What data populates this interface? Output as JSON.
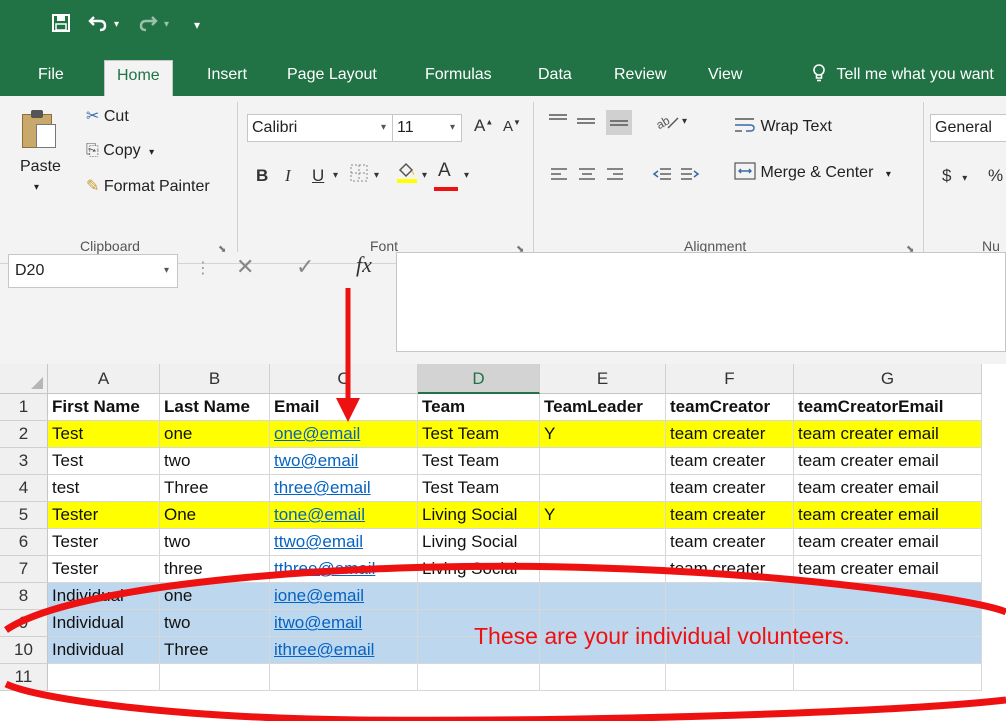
{
  "quick_access": {
    "save_icon": "save-icon",
    "undo_icon": "undo-icon",
    "redo_icon": "redo-icon",
    "customize_icon": "customize-icon"
  },
  "tabs": [
    {
      "label": "File"
    },
    {
      "label": "Home"
    },
    {
      "label": "Insert"
    },
    {
      "label": "Page Layout"
    },
    {
      "label": "Formulas"
    },
    {
      "label": "Data"
    },
    {
      "label": "Review"
    },
    {
      "label": "View"
    }
  ],
  "tell_me": "Tell me what you want",
  "ribbon": {
    "clipboard": {
      "paste": "Paste",
      "cut": "Cut",
      "copy": "Copy",
      "format_painter": "Format Painter",
      "label": "Clipboard"
    },
    "font": {
      "name": "Calibri",
      "size": "11",
      "bold": "B",
      "italic": "I",
      "underline": "U",
      "label": "Font"
    },
    "alignment": {
      "wrap_text": "Wrap Text",
      "merge_center": "Merge & Center",
      "label": "Alignment"
    },
    "number": {
      "format": "General",
      "currency": "$",
      "percent": "%",
      "label": "Nu"
    }
  },
  "formula_bar": {
    "name_box": "D20",
    "fx": "fx",
    "value": ""
  },
  "columns": [
    "A",
    "B",
    "C",
    "D",
    "E",
    "F",
    "G"
  ],
  "rows": [
    {
      "num": "1",
      "style": "header",
      "cells": [
        "First Name",
        "Last Name",
        "Email",
        "Team",
        "TeamLeader",
        "teamCreator",
        "teamCreatorEmail"
      ]
    },
    {
      "num": "2",
      "style": "yellow",
      "cells": [
        "Test",
        "one",
        "one@email",
        "Test Team",
        "Y",
        "team creater",
        "team creater email"
      ]
    },
    {
      "num": "3",
      "style": "plain",
      "cells": [
        "Test",
        "two",
        "two@email",
        "Test Team",
        "",
        "team creater",
        "team creater email"
      ]
    },
    {
      "num": "4",
      "style": "plain",
      "cells": [
        "test",
        "Three",
        "three@email",
        "Test Team",
        "",
        "team creater",
        "team creater email"
      ]
    },
    {
      "num": "5",
      "style": "yellow",
      "cells": [
        "Tester",
        "One",
        "tone@email",
        "Living Social",
        "Y",
        "team creater",
        "team creater email"
      ]
    },
    {
      "num": "6",
      "style": "plain",
      "cells": [
        "Tester",
        "two",
        "ttwo@email",
        "Living Social",
        "",
        "team creater",
        "team creater email"
      ]
    },
    {
      "num": "7",
      "style": "plain",
      "cells": [
        "Tester",
        "three",
        "tthree@email",
        "Living Social",
        "",
        "team creater",
        "team creater email"
      ]
    },
    {
      "num": "8",
      "style": "blue",
      "cells": [
        "Individual",
        "one",
        "ione@email",
        "",
        "",
        "",
        ""
      ]
    },
    {
      "num": "9",
      "style": "blue",
      "cells": [
        "Individual",
        "two",
        "itwo@email",
        "",
        "",
        "",
        ""
      ]
    },
    {
      "num": "10",
      "style": "blue",
      "cells": [
        "Individual",
        "Three",
        "ithree@email",
        "",
        "",
        "",
        ""
      ]
    },
    {
      "num": "11",
      "style": "plain",
      "cells": [
        "",
        "",
        "",
        "",
        "",
        "",
        ""
      ]
    }
  ],
  "annotation": {
    "note": "These are your individual volunteers.",
    "color": "#ee1111"
  },
  "colors": {
    "excel_green": "#217346",
    "highlight_yellow": "#ffff00",
    "highlight_blue": "#bdd7ee",
    "link_blue": "#0563c1"
  }
}
